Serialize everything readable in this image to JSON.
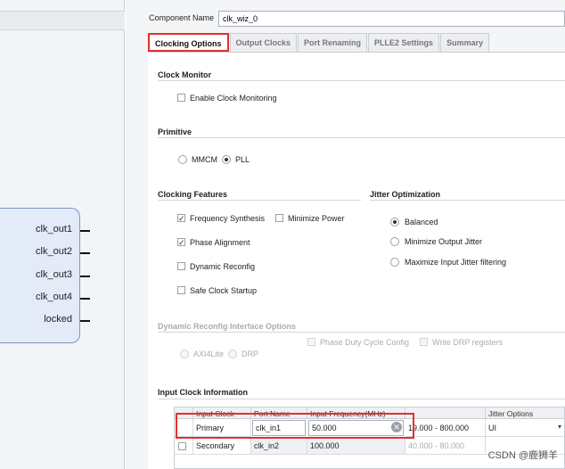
{
  "symbol": {
    "ports": [
      "clk_out1",
      "clk_out2",
      "clk_out3",
      "clk_out4",
      "locked"
    ]
  },
  "component": {
    "label": "Component Name",
    "value": "clk_wiz_0"
  },
  "tabs": [
    {
      "label": "Clocking Options",
      "active": true
    },
    {
      "label": "Output Clocks",
      "active": false
    },
    {
      "label": "Port Renaming",
      "active": false
    },
    {
      "label": "PLLE2 Settings",
      "active": false
    },
    {
      "label": "Summary",
      "active": false
    }
  ],
  "clock_monitor": {
    "title": "Clock Monitor",
    "enable_label": "Enable Clock Monitoring",
    "enabled": false
  },
  "primitive": {
    "title": "Primitive",
    "options": [
      {
        "label": "MMCM",
        "selected": false
      },
      {
        "label": "PLL",
        "selected": true
      }
    ]
  },
  "clocking_features": {
    "title": "Clocking Features",
    "frequency_synthesis": {
      "label": "Frequency Synthesis",
      "checked": true
    },
    "minimize_power": {
      "label": "Minimize Power",
      "checked": false
    },
    "phase_alignment": {
      "label": "Phase Alignment",
      "checked": true
    },
    "dynamic_reconfig": {
      "label": "Dynamic Reconfig",
      "checked": false
    },
    "safe_clock_startup": {
      "label": "Safe Clock Startup",
      "checked": false
    }
  },
  "jitter_optimization": {
    "title": "Jitter Optimization",
    "options": [
      {
        "label": "Balanced",
        "selected": true
      },
      {
        "label": "Minimize Output Jitter",
        "selected": false
      },
      {
        "label": "Maximize Input Jitter filtering",
        "selected": false
      }
    ]
  },
  "dynamic_reconfig_interface": {
    "title": "Dynamic Reconfig Interface Options",
    "phase_duty": "Phase Duty Cycle Config",
    "write_drp": "Write DRP registers",
    "axi4lite": "AXI4Lite",
    "drp": "DRP"
  },
  "input_clock": {
    "title": "Input Clock Information",
    "headers": [
      "Input Clock",
      "Port Name",
      "Input Frequency(MHz)",
      "",
      "Jitter Options"
    ],
    "rows": [
      {
        "clock": "Primary",
        "port": "clk_in1",
        "freq": "50.000",
        "range": "19.000 - 800.000",
        "jitter": "UI"
      },
      {
        "clock": "Secondary",
        "port": "clk_in2",
        "freq": "100.000",
        "range": "40.000 - 80.000",
        "jitter": ""
      }
    ]
  },
  "watermark": "CSDN @鹿狮羊",
  "colors": {
    "highlight": "#e13030",
    "symbol_fill": "#e3ebf8",
    "symbol_border": "#7d95c2"
  }
}
